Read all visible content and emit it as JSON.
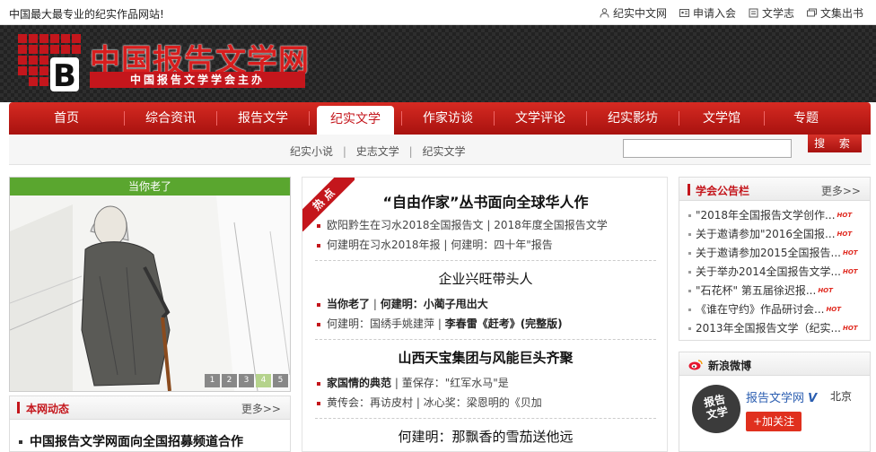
{
  "topbar": {
    "slogan": "中国最大最专业的纪实作品网站!",
    "links": [
      {
        "label": "纪实中文网",
        "icon": "person-icon"
      },
      {
        "label": "申请入会",
        "icon": "id-card-icon"
      },
      {
        "label": "文学志",
        "icon": "book-icon"
      },
      {
        "label": "文集出书",
        "icon": "stack-icon"
      }
    ]
  },
  "header": {
    "title": "中国报告文学网",
    "subtitle": "中国报告文学学会主办",
    "logo_letter": "B"
  },
  "nav": {
    "items": [
      "首页",
      "综合资讯",
      "报告文学",
      "纪实文学",
      "作家访谈",
      "文学评论",
      "纪实影坊",
      "文学馆",
      "专题"
    ],
    "active_index": 3
  },
  "subnav": {
    "links": [
      "纪实小说",
      "史志文学",
      "纪实文学"
    ],
    "divider": "|",
    "search_placeholder": "",
    "search_button": "搜 索"
  },
  "slideshow": {
    "caption": "当你老了",
    "pages": [
      "1",
      "2",
      "3",
      "4",
      "5"
    ],
    "active_page": 4
  },
  "news_dynamic": {
    "title": "本网动态",
    "more": "更多>>",
    "first_item": "中国报告文学网面向全国招募频道合作"
  },
  "hot": {
    "ribbon": "热点",
    "sections": [
      {
        "headline": "“自由作家”丛书面向全球华人作",
        "rows": [
          [
            "欧阳黔生在习水2018全国报告文",
            "2018年度全国报告文学"
          ],
          [
            "何建明在习水2018年报",
            "何建明：四十年\"报告"
          ]
        ]
      },
      {
        "headline": "企业兴旺带头人",
        "rows": [
          [
            "当你老了",
            "何建明：小蔺子甩出大"
          ],
          [
            "何建明：国绣手姚建萍",
            "李春雷《赶考》(完整版)"
          ]
        ]
      },
      {
        "headline": "山西天宝集团与风能巨头齐聚",
        "rows": [
          [
            "家国情的典范",
            "董保存：\"红军水马\"是"
          ],
          [
            "黄传会：再访皮村",
            "冰心奖：梁恩明的《贝加"
          ]
        ]
      },
      {
        "headline": "何建明：那飘香的雪茄送他远"
      }
    ]
  },
  "notice": {
    "title": "学会公告栏",
    "more": "更多>>",
    "hot_label": "HOT",
    "items": [
      "\"2018年全国报告文学创作...",
      "关于邀请参加\"2016全国报...",
      "关于邀请参加2015全国报告...",
      "关于举办2014全国报告文学...",
      "\"石花杯\" 第五届徐迟报...",
      "《谁在守约》作品研讨会...",
      "2013年全国报告文学（纪实..."
    ]
  },
  "weibo": {
    "title": "新浪微博",
    "avatar_text": [
      "报告",
      "文学"
    ],
    "name": "报告文学网",
    "verified": "V",
    "location": "北京",
    "follow": "+加关注"
  }
}
